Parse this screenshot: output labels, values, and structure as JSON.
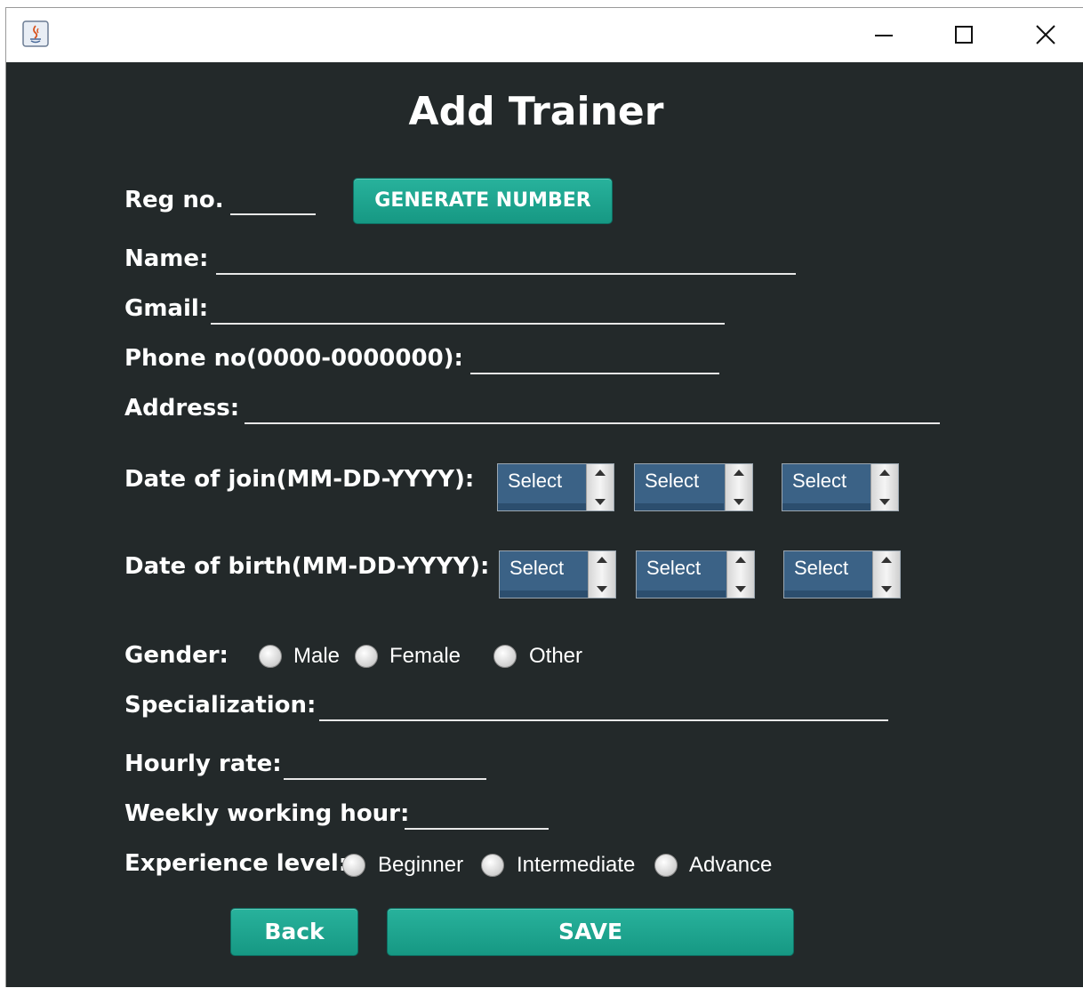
{
  "window": {
    "title": ""
  },
  "form": {
    "title": "Add Trainer",
    "reg_label": "Reg no.",
    "generate_button": "GENERATE NUMBER",
    "name_label": "Name:",
    "gmail_label": "Gmail:",
    "phone_label": "Phone no(0000-0000000):",
    "address_label": "Address:",
    "join_label": "Date of join(MM-DD-YYYY):",
    "birth_label": "Date of birth(MM-DD-YYYY):",
    "select_placeholder": "Select",
    "gender_label": "Gender:",
    "gender_options": [
      "Male",
      "Female",
      "Other"
    ],
    "specialization_label": "Specialization:",
    "hourly_label": "Hourly rate:",
    "weekly_label": "Weekly working hour:",
    "experience_label": "Experience level:",
    "experience_options": [
      "Beginner",
      "Intermediate",
      "Advance"
    ],
    "back_button": "Back",
    "save_button": "SAVE"
  },
  "colors": {
    "background": "#23292a",
    "button": "#1fa58f",
    "combo": "#3b6286"
  }
}
